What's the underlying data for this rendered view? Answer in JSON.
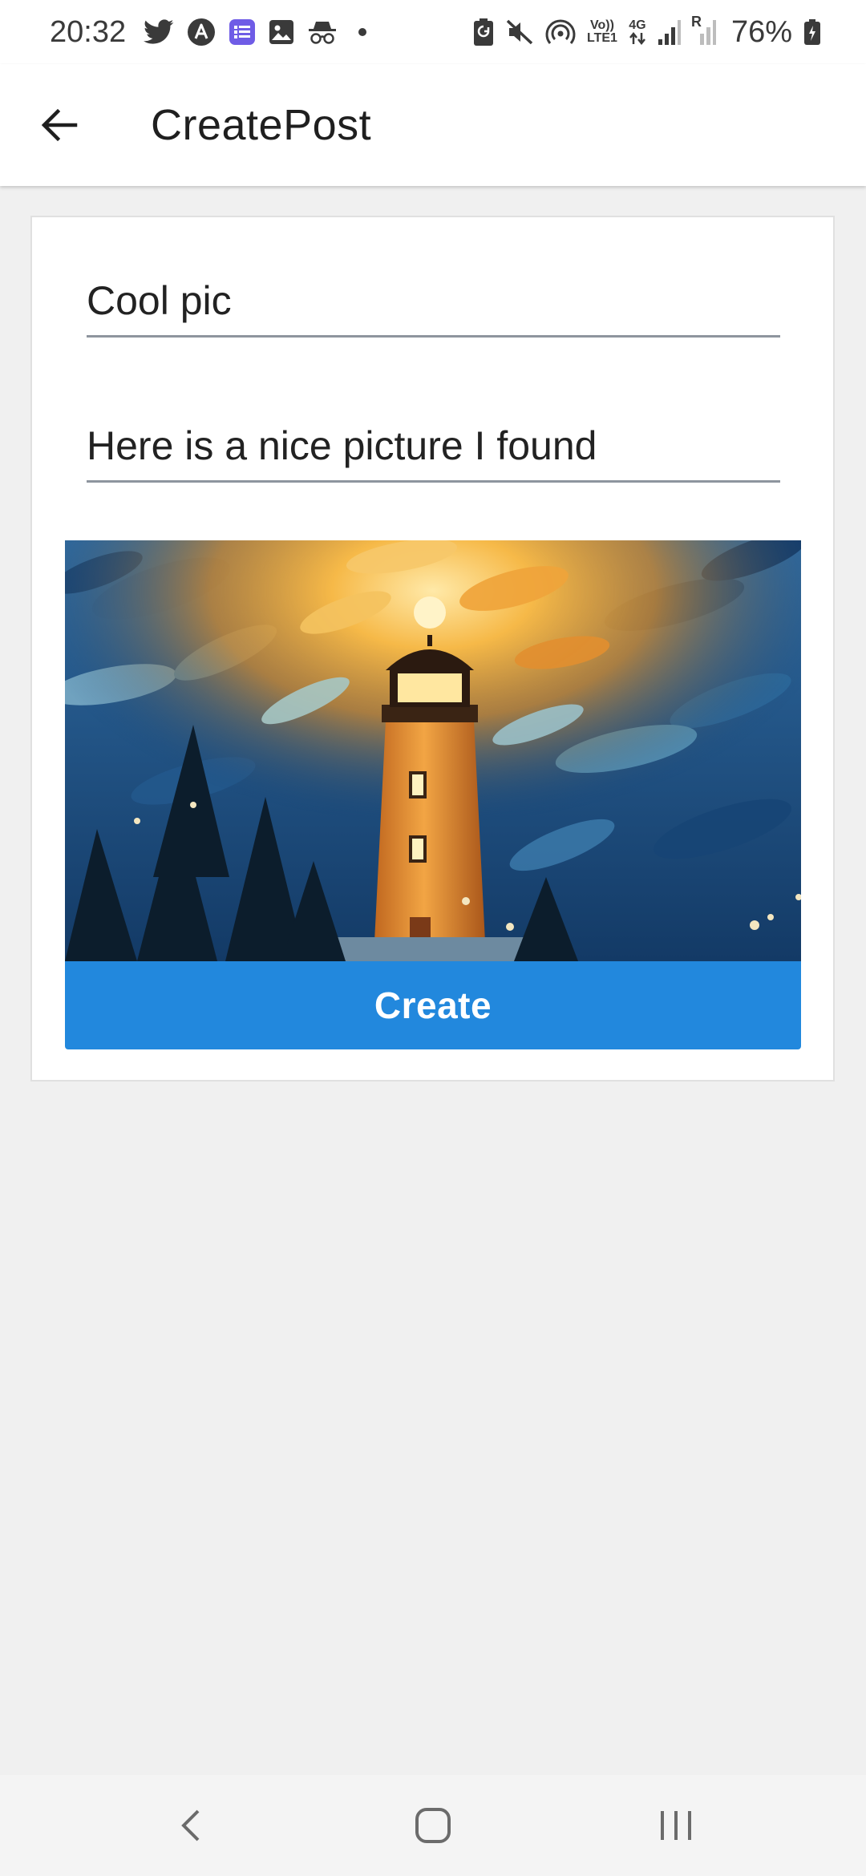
{
  "status_bar": {
    "time": "20:32",
    "notification_icons": [
      "twitter-icon",
      "arc-icon",
      "list-app-icon",
      "gallery-icon",
      "incognito-icon"
    ],
    "system_icons": [
      "battery-saver-icon",
      "mute-icon",
      "hotspot-icon",
      "volte-icon",
      "4g-data-icon",
      "signal-icon",
      "signal-roaming-icon"
    ],
    "volte_label_top": "Vo))",
    "volte_label_bottom": "LTE1",
    "network_label": "4G",
    "roaming_label": "R",
    "battery_percent": "76%"
  },
  "app_bar": {
    "back_icon": "arrow-back-icon",
    "title": "CreatePost"
  },
  "form": {
    "title_value": "Cool pic",
    "description_value": "Here is a nice picture I found",
    "image_subject": "painted lighthouse at night",
    "create_label": "Create"
  },
  "nav_bar": {
    "back_icon": "nav-back-icon",
    "home_icon": "nav-home-icon",
    "recents_icon": "nav-recents-icon"
  },
  "colors": {
    "primary_button": "#2288dd",
    "background": "#f0f0f0",
    "card": "#ffffff",
    "field_underline": "#8e959e"
  }
}
